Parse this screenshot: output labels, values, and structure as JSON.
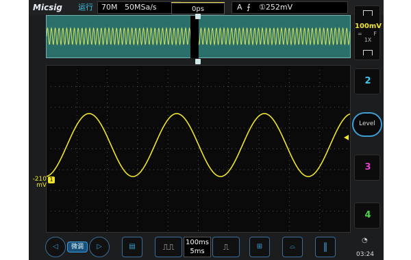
{
  "app": {
    "logo": "Micsig",
    "run_state": "运行"
  },
  "topbar": {
    "timebase": "70M",
    "sample_rate": "50MSa/s",
    "trigger_offset": "0ps",
    "trigger_source": "A",
    "trigger_edge_icon": "rising-edge-icon",
    "trigger_level": "①252mV"
  },
  "channel1": {
    "scale": "100mV",
    "coupling": "=",
    "bandwidth": "F",
    "probe": "1X",
    "offset_label_line1": "-210",
    "offset_label_line2": "mV",
    "marker": "1",
    "color": "#f2e62a"
  },
  "channels": {
    "ch2": "2",
    "ch3": "3",
    "ch4": "4"
  },
  "level_knob": "Level",
  "bottombar": {
    "fine_label": "微调",
    "timebase_main": "100ms",
    "timebase_zoom": "5ms",
    "time": "03:24"
  },
  "icons": {
    "left_arrow": "left-arrow-icon",
    "right_arrow": "right-arrow-icon",
    "save": "save-icon",
    "tb_decrease": "pulse-narrow-icon",
    "tb_increase": "pulse-wide-icon",
    "measure": "measure-icon",
    "car": "automotive-icon",
    "pause": "pause-icon",
    "wifi": "wifi-icon"
  },
  "colors": {
    "ch1": "#f2e62a",
    "ch2": "#3ec7e8",
    "ch3": "#e040c8",
    "ch4": "#4bd24b",
    "accent": "#3ea0d8"
  }
}
